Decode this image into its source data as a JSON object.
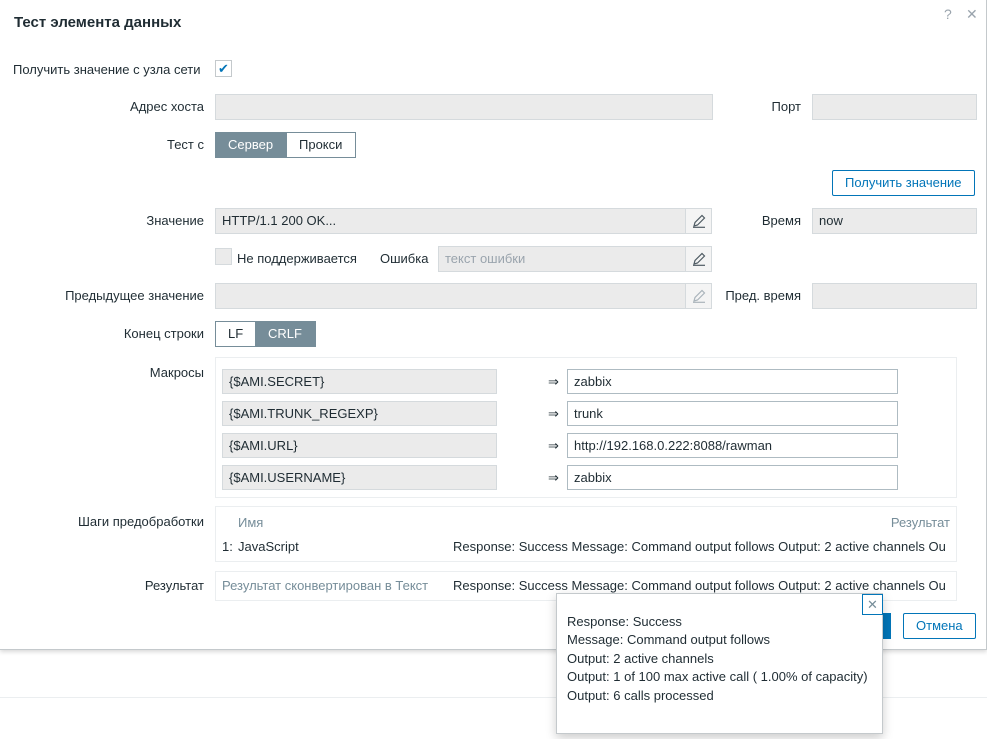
{
  "dialog": {
    "title": "Тест элемента данных",
    "help_icon": "?",
    "close_icon": "✕"
  },
  "get_from_host": {
    "label": "Получить значение с узла сети",
    "checked": true
  },
  "host": {
    "label": "Адрес хоста",
    "value": "",
    "port_label": "Порт",
    "port_value": ""
  },
  "test_with": {
    "label": "Тест с",
    "options": [
      "Сервер",
      "Прокси"
    ],
    "selected": "Сервер"
  },
  "get_value_button": "Получить значение",
  "value": {
    "label": "Значение",
    "value": "HTTP/1.1 200 OK...",
    "time_label": "Время",
    "time_value": "now"
  },
  "not_supported": {
    "label": "Не поддерживается",
    "error_label": "Ошибка",
    "error_placeholder": "текст ошибки"
  },
  "prev_value": {
    "label": "Предыдущее значение",
    "value": "",
    "time_label": "Пред. время",
    "time_value": ""
  },
  "eol": {
    "label": "Конец строки",
    "options": [
      "LF",
      "CRLF"
    ],
    "selected": "CRLF"
  },
  "macros": {
    "label": "Макросы",
    "arrow": "⇒",
    "items": [
      {
        "name": "{$AMI.SECRET}",
        "value": "zabbix"
      },
      {
        "name": "{$AMI.TRUNK_REGEXP}",
        "value": "trunk"
      },
      {
        "name": "{$AMI.URL}",
        "value": "http://192.168.0.222:8088/rawman"
      },
      {
        "name": "{$AMI.USERNAME}",
        "value": "zabbix"
      }
    ]
  },
  "preprocessing": {
    "label": "Шаги предобработки",
    "col_name": "Имя",
    "col_result": "Результат",
    "steps": [
      {
        "num": "1:",
        "name": "JavaScript",
        "result": "Response: Success Message: Command output follows Output: 2 active channels Ou"
      }
    ]
  },
  "result": {
    "label": "Результат",
    "converted": "Результат сконвертирован в Текст",
    "value": "Response: Success Message: Command output follows Output: 2 active channels Ou"
  },
  "cancel_button": "Отмена",
  "popup": {
    "close_icon": "✕",
    "lines": [
      "Response: Success",
      "Message: Command output follows",
      "Output: 2 active channels",
      "Output: 1 of 100 max active call ( 1.00% of capacity)",
      "Output: 6 calls processed"
    ]
  }
}
